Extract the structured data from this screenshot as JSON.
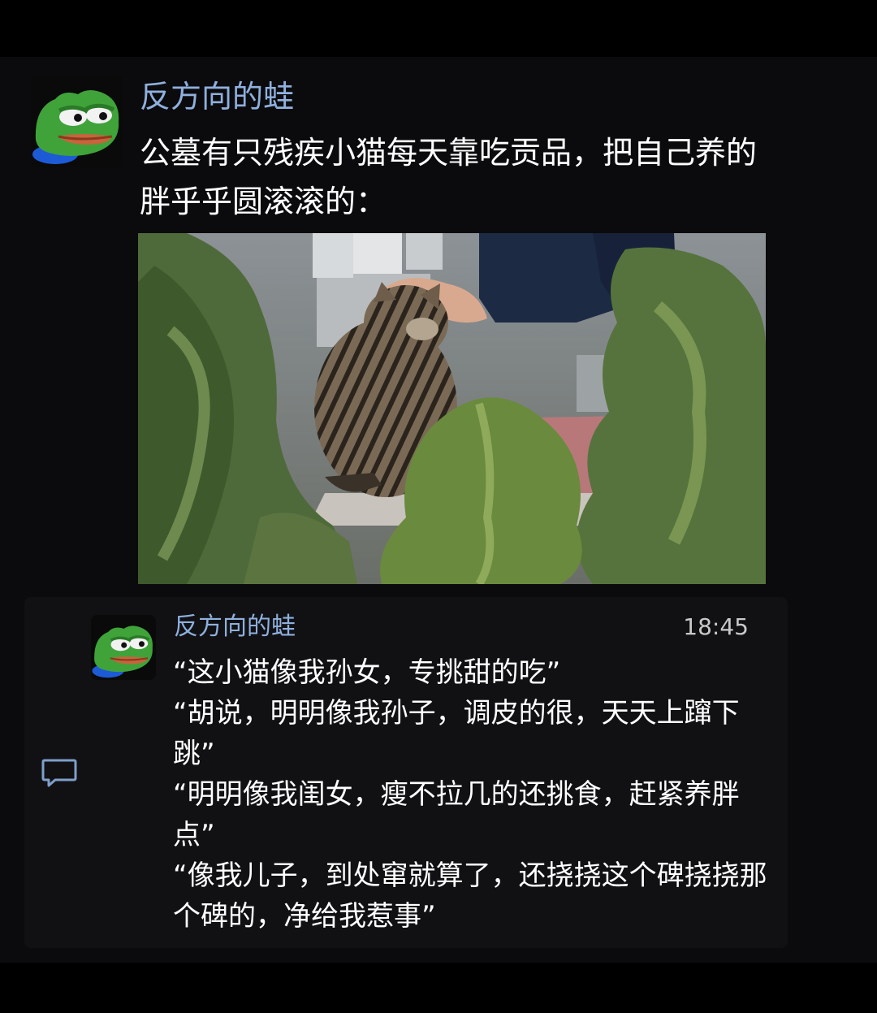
{
  "post": {
    "author": "反方向的蛙",
    "text": "公墓有只残疾小猫每天靠吃贡品，把自己养的胖乎乎圆滚滚的：",
    "avatar_icon": "pepe-frog-avatar-icon",
    "photo_icon": "tabby-cat-photo"
  },
  "comment": {
    "author": "反方向的蛙",
    "time": "18:45",
    "avatar_icon": "pepe-frog-avatar-icon",
    "comment_icon": "comment-bubble-icon",
    "lines": [
      "“这小猫像我孙女，专挑甜的吃”",
      "“胡说，明明像我孙子，调皮的很，天天上蹿下跳”",
      "“明明像我闺女，瘦不拉几的还挑食，赶紧养胖点”",
      "“像我儿子，到处窜就算了，还挠挠这个碑挠挠那个碑的，净给我惹事”"
    ]
  },
  "colors": {
    "background": "#000000",
    "panel": "#0b0b0d",
    "card": "#111114",
    "name": "#8fb0de",
    "text": "#ffffff",
    "time": "#c9c9c9"
  }
}
